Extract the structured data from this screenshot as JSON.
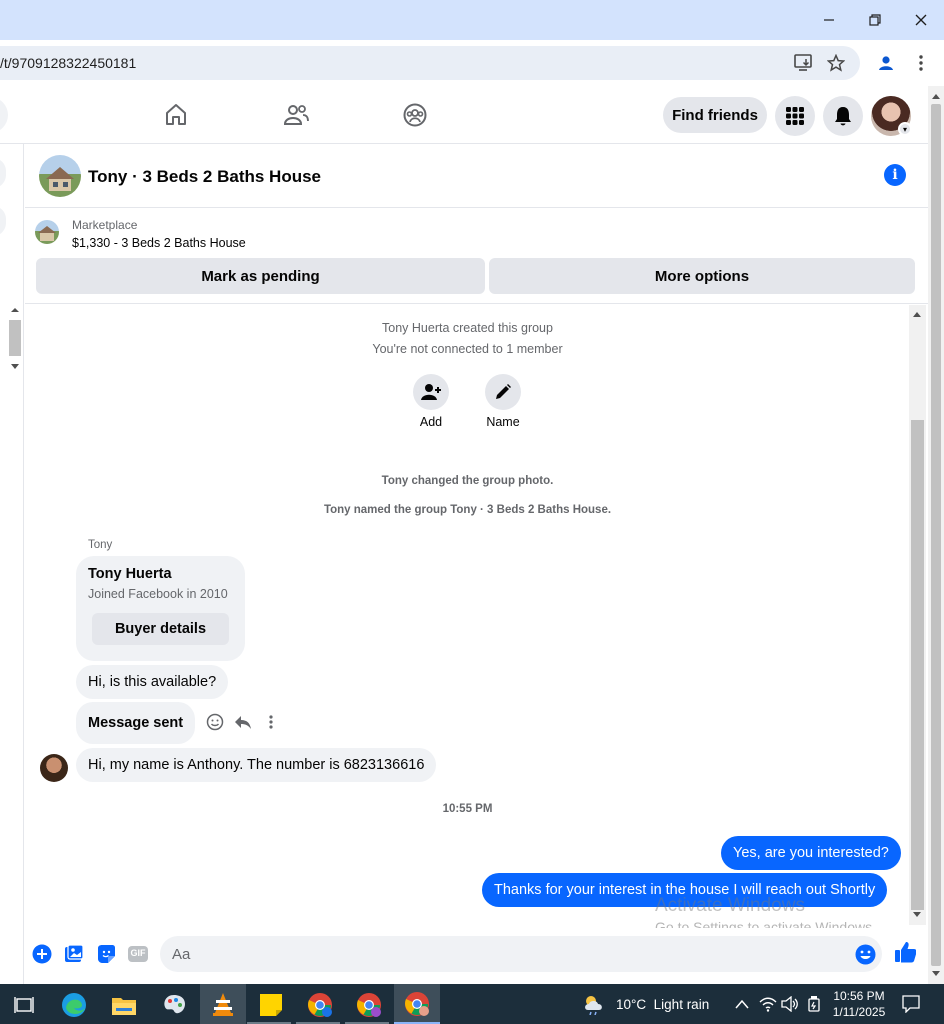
{
  "browser": {
    "url": "/t/9709128322450181"
  },
  "nav": {
    "find_friends": "Find friends"
  },
  "chat": {
    "title": "Tony · 3 Beds 2 Baths House",
    "marketplace_label": "Marketplace",
    "listing": "$1,330 - 3 Beds 2 Baths House",
    "mark_pending": "Mark as pending",
    "more_options": "More options"
  },
  "messages": {
    "created": "Tony Huerta created this group",
    "not_connected": "You're not connected to 1 member",
    "add_label": "Add",
    "name_label": "Name",
    "changed_photo": "Tony changed the group photo.",
    "named_group": "Tony named the group Tony · 3 Beds 2 Baths House.",
    "sender": "Tony",
    "card_name": "Tony Huerta",
    "card_sub": "Joined Facebook in 2010",
    "buyer_details": "Buyer details",
    "msg1": "Hi, is this available?",
    "msg2": "Message sent",
    "msg3": "Hi, my name is Anthony. The number is 6823136616",
    "time": "10:55 PM",
    "out1": "Yes, are you interested?",
    "out2": "Thanks for your interest in the house I will reach out Shortly"
  },
  "composer": {
    "placeholder": "Aa",
    "gif": "GIF"
  },
  "watermark": {
    "line1": "Activate Windows",
    "line2": "Go to Settings to activate Windows."
  },
  "taskbar": {
    "weather": "10°C  Light rain",
    "time": "10:56 PM",
    "date": "1/11/2025"
  },
  "colors": {
    "brand_blue": "#0866ff",
    "taskbar": "#1c2e3b"
  }
}
